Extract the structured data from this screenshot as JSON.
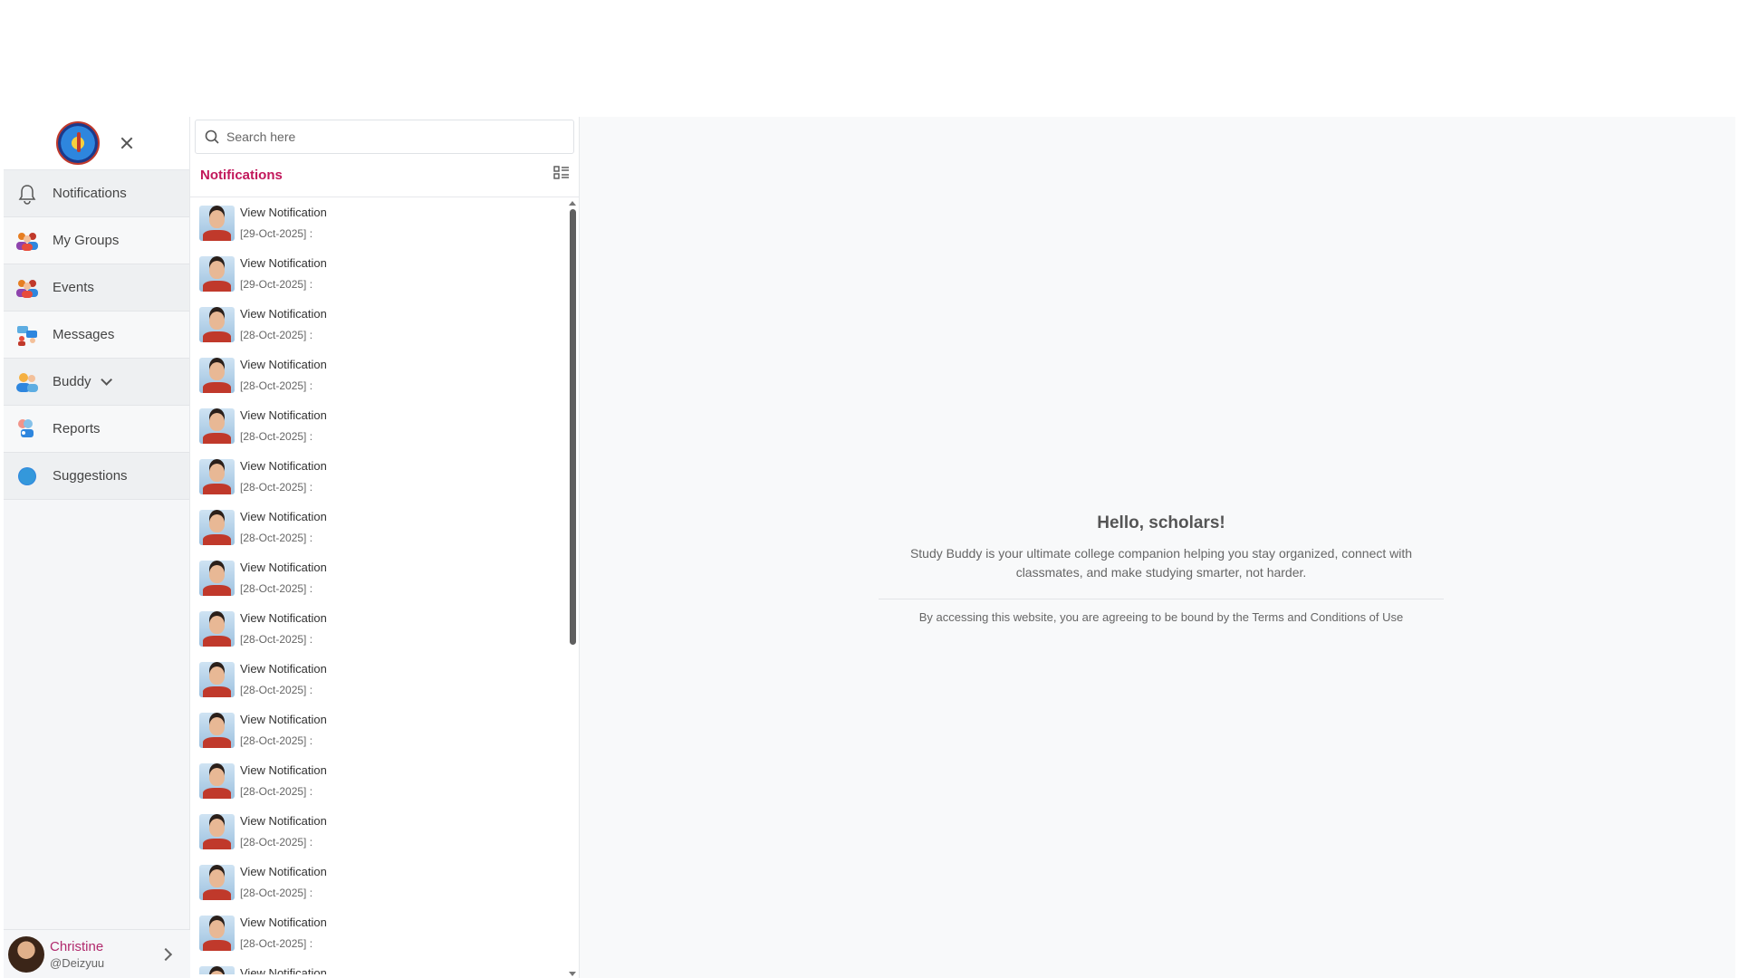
{
  "sidebar": {
    "items": [
      {
        "label": "Notifications",
        "icon": "bell-icon"
      },
      {
        "label": "My Groups",
        "icon": "group-icon"
      },
      {
        "label": "Events",
        "icon": "events-icon"
      },
      {
        "label": "Messages",
        "icon": "messages-icon"
      },
      {
        "label": "Buddy",
        "icon": "buddy-icon"
      },
      {
        "label": "Reports",
        "icon": "reports-icon"
      },
      {
        "label": "Suggestions",
        "icon": "suggestions-icon"
      }
    ],
    "user": {
      "name": "Christine",
      "handle": "@Deizyuu"
    }
  },
  "search": {
    "placeholder": "Search here"
  },
  "notifications": {
    "title": "Notifications",
    "items": [
      {
        "title": "View Notification",
        "date": "[29-Oct-2025] :"
      },
      {
        "title": "View Notification",
        "date": "[29-Oct-2025] :"
      },
      {
        "title": "View Notification",
        "date": "[28-Oct-2025] :"
      },
      {
        "title": "View Notification",
        "date": "[28-Oct-2025] :"
      },
      {
        "title": "View Notification",
        "date": "[28-Oct-2025] :"
      },
      {
        "title": "View Notification",
        "date": "[28-Oct-2025] :"
      },
      {
        "title": "View Notification",
        "date": "[28-Oct-2025] :"
      },
      {
        "title": "View Notification",
        "date": "[28-Oct-2025] :"
      },
      {
        "title": "View Notification",
        "date": "[28-Oct-2025] :"
      },
      {
        "title": "View Notification",
        "date": "[28-Oct-2025] :"
      },
      {
        "title": "View Notification",
        "date": "[28-Oct-2025] :"
      },
      {
        "title": "View Notification",
        "date": "[28-Oct-2025] :"
      },
      {
        "title": "View Notification",
        "date": "[28-Oct-2025] :"
      },
      {
        "title": "View Notification",
        "date": "[28-Oct-2025] :"
      },
      {
        "title": "View Notification",
        "date": "[28-Oct-2025] :"
      },
      {
        "title": "View Notification",
        "date": ""
      }
    ]
  },
  "welcome": {
    "title": "Hello, scholars!",
    "text": "Study Buddy is your ultimate college companion helping you stay organized, connect with classmates, and make studying smarter, not harder.",
    "terms": "By accessing this website, you are agreeing to be bound by the Terms and Conditions of Use"
  },
  "colors": {
    "accent": "#c2185b",
    "username": "#b12a6d"
  }
}
